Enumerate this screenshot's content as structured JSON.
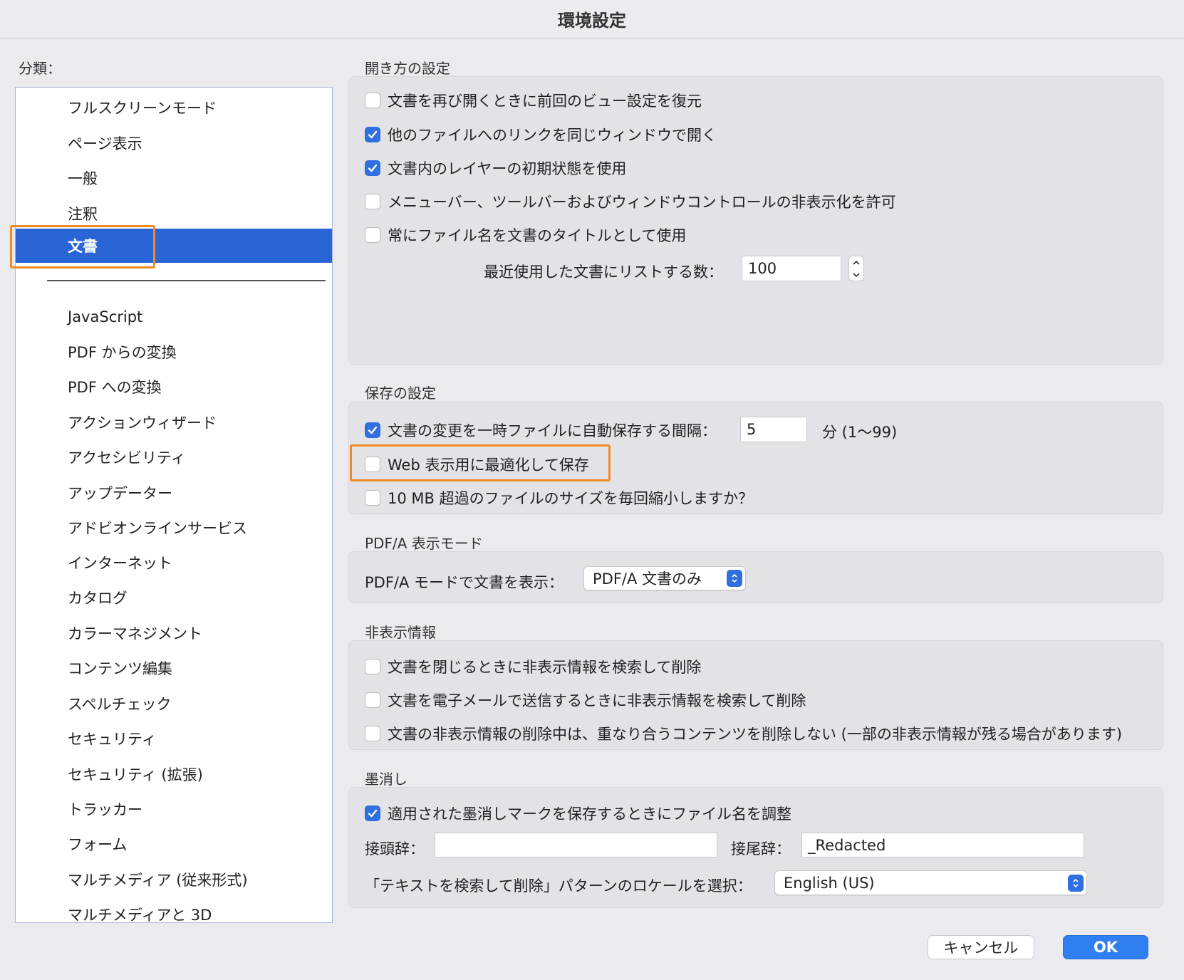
{
  "window": {
    "title": "環境設定"
  },
  "sidebar": {
    "heading": "分類：",
    "items_top": [
      "フルスクリーンモード",
      "ページ表示",
      "一般",
      "注釈",
      "文書"
    ],
    "selected": "文書",
    "items_bottom": [
      "JavaScript",
      "PDF からの変換",
      "PDF への変換",
      "アクションウィザード",
      "アクセシビリティ",
      "アップデーター",
      "アドビオンラインサービス",
      "インターネット",
      "カタログ",
      "カラーマネジメント",
      "コンテンツ編集",
      "スペルチェック",
      "セキュリティ",
      "セキュリティ (拡張)",
      "トラッカー",
      "フォーム",
      "マルチメディア (従来形式)",
      "マルチメディアと 3D"
    ]
  },
  "open_settings": {
    "title": "開き方の設定",
    "options": [
      {
        "label": "文書を再び開くときに前回のビュー設定を復元",
        "checked": false
      },
      {
        "label": "他のファイルへのリンクを同じウィンドウで開く",
        "checked": true
      },
      {
        "label": "文書内のレイヤーの初期状態を使用",
        "checked": true
      },
      {
        "label": "メニューバー、ツールバーおよびウィンドウコントロールの非表示化を許可",
        "checked": false
      },
      {
        "label": "常にファイル名を文書のタイトルとして使用",
        "checked": false
      }
    ],
    "recent_label": "最近使用した文書にリストする数：",
    "recent_value": "100"
  },
  "save_settings": {
    "title": "保存の設定",
    "autosave": {
      "label": "文書の変更を一時ファイルに自動保存する間隔：",
      "checked": true,
      "value": "5",
      "unit": "分 (1〜99)"
    },
    "web_optimize": {
      "label": "Web 表示用に最適化して保存",
      "checked": false
    },
    "reduce_size": {
      "label": "10 MB 超過のファイルのサイズを毎回縮小しますか？",
      "checked": false
    }
  },
  "pdfa": {
    "title": "PDF/A 表示モード",
    "label": "PDF/A モードで文書を表示：",
    "value": "PDF/A 文書のみ"
  },
  "hidden_info": {
    "title": "非表示情報",
    "options": [
      {
        "label": "文書を閉じるときに非表示情報を検索して削除",
        "checked": false
      },
      {
        "label": "文書を電子メールで送信するときに非表示情報を検索して削除",
        "checked": false
      },
      {
        "label": "文書の非表示情報の削除中は、重なり合うコンテンツを削除しない (一部の非表示情報が残る場合があります)",
        "checked": false
      }
    ]
  },
  "redaction": {
    "title": "墨消し",
    "adjust": {
      "label": "適用された墨消しマークを保存するときにファイル名を調整",
      "checked": true
    },
    "prefix_label": "接頭辞：",
    "prefix_value": "",
    "suffix_label": "接尾辞：",
    "suffix_value": "_Redacted",
    "locale_label": "「テキストを検索して削除」パターンのロケールを選択：",
    "locale_value": "English (US)"
  },
  "buttons": {
    "cancel": "キャンセル",
    "ok": "OK"
  },
  "colors": {
    "accent": "#2f6fe0",
    "selection": "#2a65d6",
    "highlight": "#f08a24"
  }
}
